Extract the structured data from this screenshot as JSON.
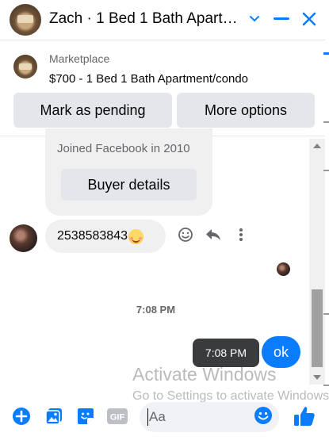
{
  "header": {
    "title": "Zach · 1 Bed 1 Bath Apartm…",
    "accent_color": "#0a7cff"
  },
  "marketplace": {
    "label": "Marketplace",
    "listing": "$700 - 1 Bed 1 Bath Apartment/condo",
    "mark_pending_label": "Mark as pending",
    "more_options_label": "More options"
  },
  "conversation": {
    "joined_text": "Joined Facebook in 2010",
    "buyer_details_label": "Buyer details",
    "received_message": "2538583843",
    "received_emoji": "smiling-face",
    "timestamp": "7:08 PM",
    "tooltip_time": "7:08 PM",
    "sent_message": "ok",
    "sent_bubble_color": "#0a7cff"
  },
  "watermark": {
    "line1": "Activate Windows",
    "line2": "Go to Settings to activate Windows."
  },
  "composer": {
    "placeholder": "Aa",
    "icons": [
      "plus-icon",
      "photo-icon",
      "sticker-icon",
      "gif-icon",
      "emoji-icon",
      "thumbs-up-icon"
    ],
    "gif_label": "GIF"
  }
}
